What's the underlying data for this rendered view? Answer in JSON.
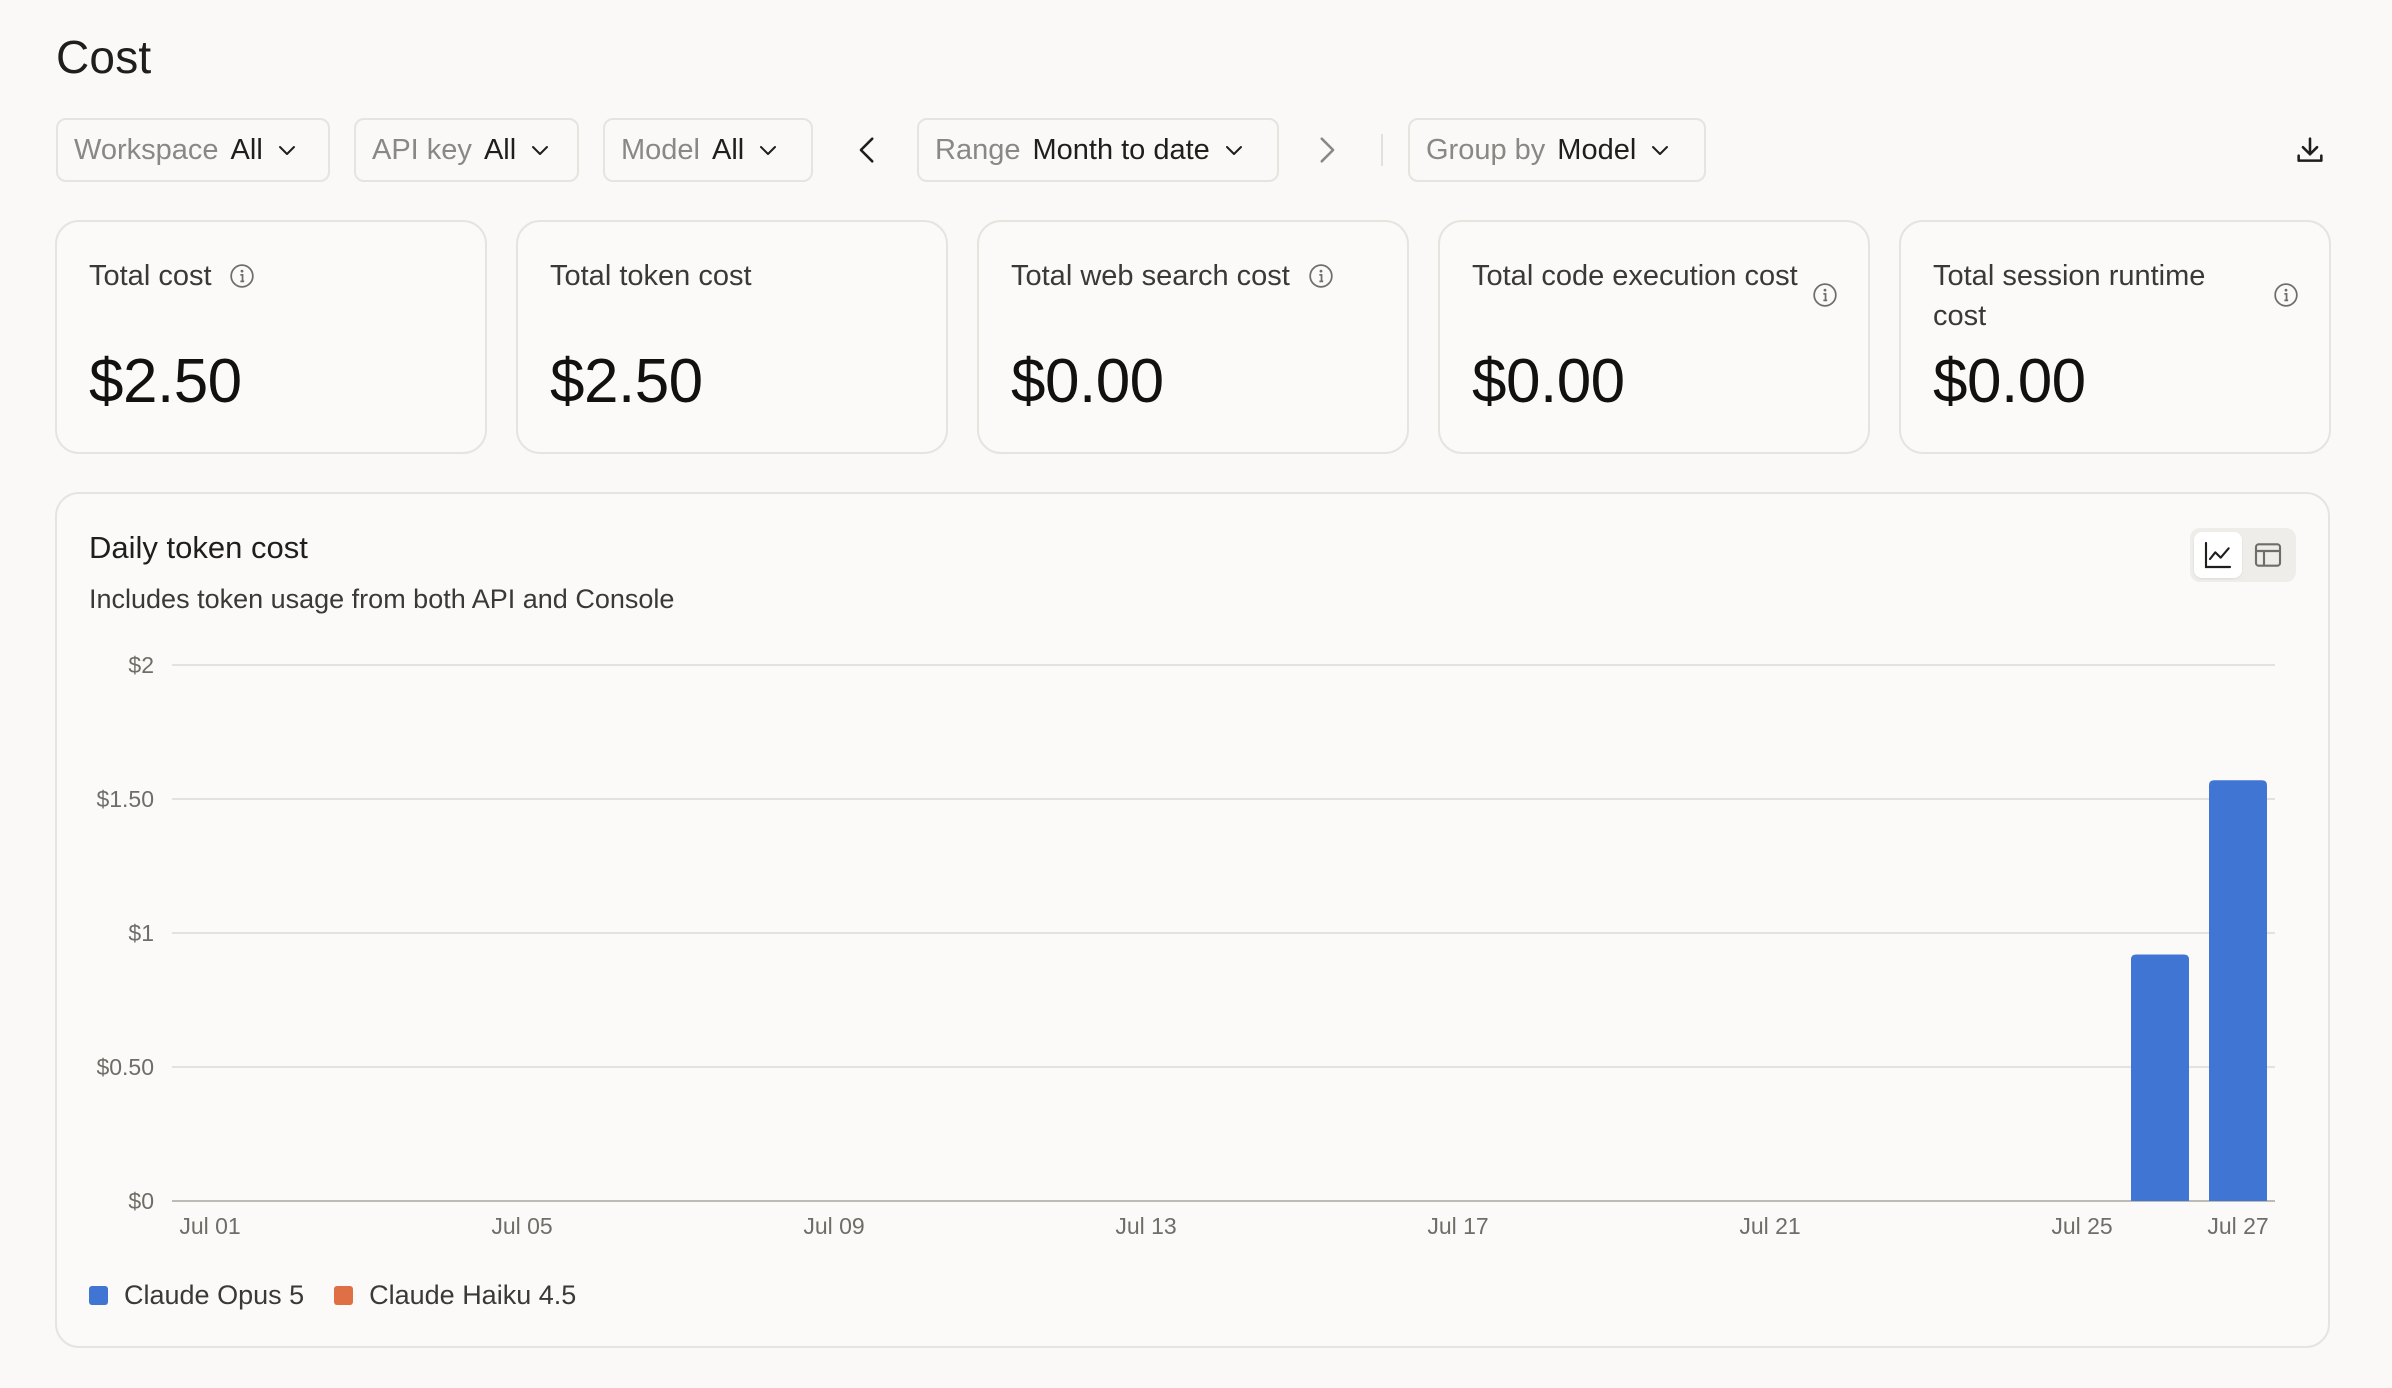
{
  "page": {
    "title": "Cost"
  },
  "filters": {
    "workspace": {
      "label": "Workspace",
      "value": "All"
    },
    "api_key": {
      "label": "API key",
      "value": "All"
    },
    "model": {
      "label": "Model",
      "value": "All"
    },
    "range": {
      "label": "Range",
      "value": "Month to date"
    },
    "group_by": {
      "label": "Group by",
      "value": "Model"
    }
  },
  "icons": {
    "prev": "chevron-left-icon",
    "next": "chevron-right-icon",
    "dropdown": "chevron-down-icon",
    "download": "download-icon",
    "info": "info-icon",
    "line_view": "line-chart-icon",
    "table_view": "table-icon"
  },
  "cards": [
    {
      "title": "Total cost",
      "value": "$2.50",
      "info": true
    },
    {
      "title": "Total token cost",
      "value": "$2.50",
      "info": false
    },
    {
      "title": "Total web search cost",
      "value": "$0.00",
      "info": true
    },
    {
      "title": "Total code execution cost",
      "value": "$0.00",
      "info": true
    },
    {
      "title": "Total session runtime cost",
      "value": "$0.00",
      "info": true
    }
  ],
  "chart_section": {
    "title": "Daily token cost",
    "subtitle": "Includes token usage from both API and Console"
  },
  "colors": {
    "opus": "#4175d3",
    "haiku": "#df6f44",
    "grid": "#e4e2de",
    "axis_text": "#6f6d68"
  },
  "chart_data": {
    "type": "bar",
    "title": "Daily token cost",
    "subtitle": "Includes token usage from both API and Console",
    "x_tick_labels": [
      "Jul 01",
      "Jul 05",
      "Jul 09",
      "Jul 13",
      "Jul 17",
      "Jul 21",
      "Jul 25",
      "Jul 27"
    ],
    "y_tick_labels": [
      "$0",
      "$0.50",
      "$1",
      "$1.50",
      "$2"
    ],
    "y_ticks": [
      0,
      0.5,
      1,
      1.5,
      2
    ],
    "ylim": [
      0,
      2
    ],
    "x_range": [
      "2025-07-01",
      "2025-07-27"
    ],
    "categories": [
      "Jul 26",
      "Jul 27"
    ],
    "series": [
      {
        "name": "Claude Opus 5",
        "values": [
          0.92,
          1.57
        ]
      },
      {
        "name": "Claude Haiku 4.5",
        "values": [
          0,
          0
        ]
      }
    ],
    "grid": true,
    "legend": "bottom-left",
    "stacked": true
  }
}
